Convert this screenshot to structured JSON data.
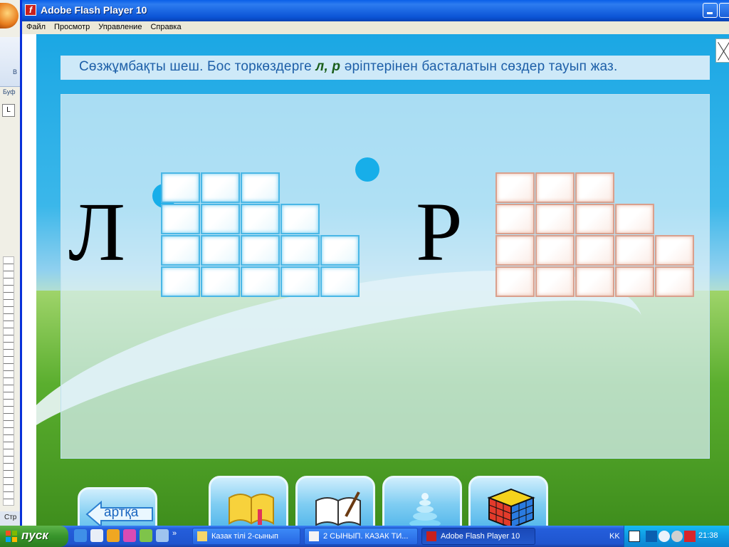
{
  "window": {
    "title": "Adobe Flash Player 10",
    "menu": [
      "Файл",
      "Просмотр",
      "Управление",
      "Справка"
    ]
  },
  "background_app": {
    "ribbon_text": "В",
    "ribbon_label": "Буф",
    "status_text": "Стр"
  },
  "activity": {
    "instruction_before": "Сөзжұмбақты шеш. Бос торкөздерге ",
    "instruction_letters": "л, р",
    "instruction_after": " әріптерінен басталатын сөздер тауып жаз.",
    "letter_left": "Л",
    "letter_right": "Р",
    "left_grid_rows": [
      3,
      4,
      5,
      5
    ],
    "right_grid_rows": [
      3,
      4,
      5,
      5
    ],
    "colors": {
      "left_cells": "#4ab7e6",
      "right_cells": "#d9a08d",
      "instruction_text": "#1d5fa8",
      "highlight_letters": "#1a5e1a"
    }
  },
  "nav": {
    "back_label": "артқа",
    "icons": [
      "book-icon",
      "notebook-pen-icon",
      "pyramid-icon",
      "rubiks-cube-icon"
    ]
  },
  "taskbar": {
    "start_label": "пуск",
    "tasks": [
      "Казак тілі 2-сынып",
      "2 СЫНЫП. КАЗАК ТИ...",
      "Adobe Flash Player 10"
    ],
    "language": "KK",
    "clock": "21:38"
  }
}
